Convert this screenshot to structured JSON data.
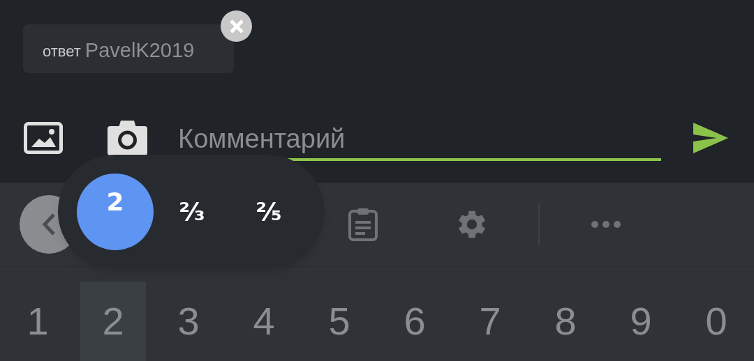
{
  "reply_chip": {
    "prefix": "ответ",
    "username": "PavelK2019"
  },
  "comment_field": {
    "placeholder": "Комментарий",
    "focused": true
  },
  "toolbar": {
    "items": [
      {
        "kind": "back"
      },
      {
        "kind": "clipboard"
      },
      {
        "kind": "settings"
      },
      {
        "kind": "divider"
      },
      {
        "kind": "more"
      }
    ]
  },
  "fraction_popup": {
    "options": [
      {
        "label": "2",
        "selected": true
      },
      {
        "label": "²⁄₃",
        "selected": false
      },
      {
        "label": "²⁄₅",
        "selected": false
      }
    ]
  },
  "number_keys": [
    {
      "label": "1",
      "pressed": false
    },
    {
      "label": "2",
      "pressed": true
    },
    {
      "label": "3",
      "pressed": false
    },
    {
      "label": "4",
      "pressed": false
    },
    {
      "label": "5",
      "pressed": false
    },
    {
      "label": "6",
      "pressed": false
    },
    {
      "label": "7",
      "pressed": false
    },
    {
      "label": "8",
      "pressed": false
    },
    {
      "label": "9",
      "pressed": false
    },
    {
      "label": "0",
      "pressed": false
    }
  ]
}
